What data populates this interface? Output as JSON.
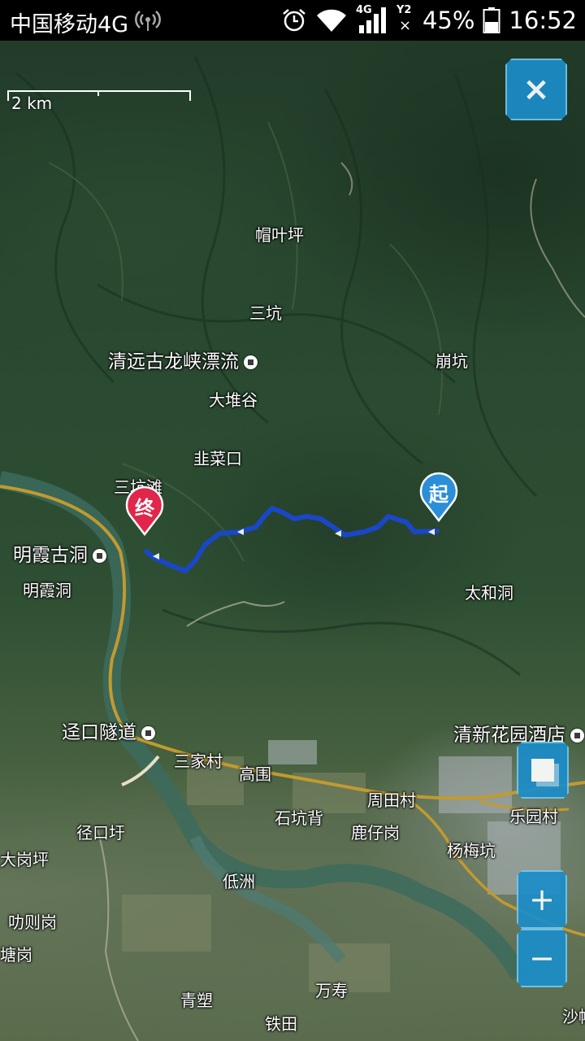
{
  "status_bar": {
    "carrier": "中国移动4G",
    "network": "4G",
    "sim_indicator": "Y2",
    "battery": "45%",
    "time": "16:52",
    "icons": [
      "hotspot-icon",
      "alarm-icon",
      "wifi-icon",
      "signal-icon",
      "sim-icon",
      "battery-icon"
    ]
  },
  "map": {
    "scale_label": "2 km",
    "places": {
      "maoyeping": "帽叶坪",
      "sankeng": "三坑",
      "qingyuan_gulongxia": "清远古龙峡漂流",
      "bengkeng": "崩坑",
      "daduigu": "大堆谷",
      "jiucaikou": "韭菜口",
      "sankengtan": "三坑滩",
      "mingxia_gudong": "明霞古洞",
      "mingxiadong": "明霞洞",
      "taihedong": "太和洞",
      "jingkou_suidao": "迳口隧道",
      "qingxin_hotel": "清新花园酒店",
      "sanjiacun": "三家村",
      "gaowei": "高围",
      "zhoutiancun": "周田村",
      "leyuancun": "乐园村",
      "shikengbei": "石坑背",
      "luzaigang": "鹿仔岗",
      "yangmeikeng": "杨梅坑",
      "jingkouwei": "径口圩",
      "dagangping": "大岗坪",
      "dizhou": "低洲",
      "dizegang": "叻则岗",
      "tanggang": "塘岗",
      "qingsu": "青塑",
      "wanshou": "万寿",
      "tietian": "铁田",
      "sha": "沙帷"
    },
    "markers": {
      "start_label": "起",
      "end_label": "终",
      "start_color": "#2a8fd8",
      "end_color": "#e0264a"
    },
    "route_color": "#1a47c8"
  },
  "controls": {
    "close_label": "×",
    "zoom_in_label": "+",
    "zoom_out_label": "−",
    "layer_icon": "layers-square-icon"
  }
}
